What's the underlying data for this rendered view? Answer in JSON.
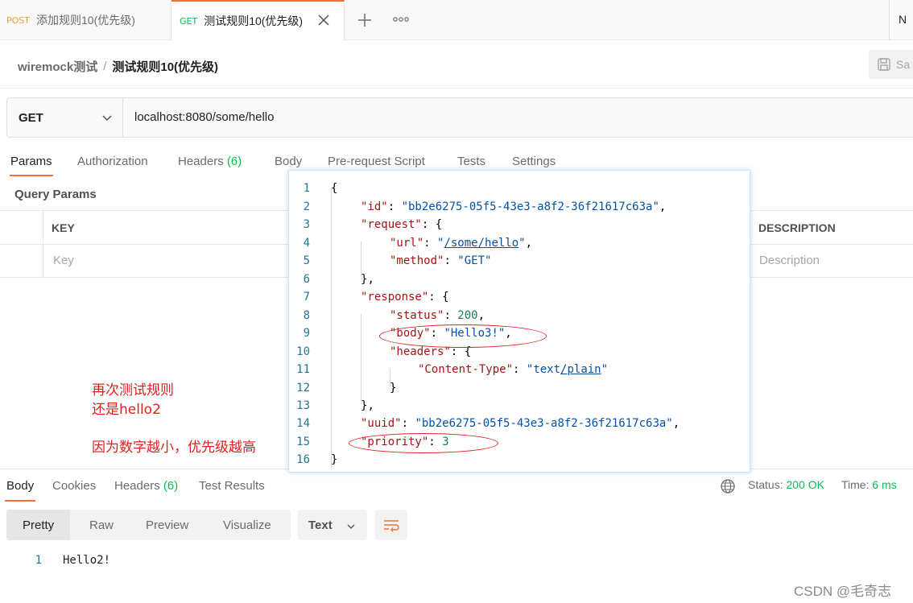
{
  "tabs": [
    {
      "method": "POST",
      "title": "添加规则10(优先级)"
    },
    {
      "method": "GET",
      "title": "测试规则10(优先级)"
    }
  ],
  "tabbar_right_text": "N",
  "breadcrumb": {
    "parent": "wiremock测试",
    "separator": "/",
    "current": "测试规则10(优先级)"
  },
  "save_label": "Sa",
  "request": {
    "method": "GET",
    "url": "localhost:8080/some/hello"
  },
  "request_tabs": [
    {
      "label": "Params",
      "count": ""
    },
    {
      "label": "Authorization",
      "count": ""
    },
    {
      "label": "Headers",
      "count": "(6)"
    },
    {
      "label": "Body",
      "count": ""
    },
    {
      "label": "Pre-request Script",
      "count": ""
    },
    {
      "label": "Tests",
      "count": ""
    },
    {
      "label": "Settings",
      "count": ""
    }
  ],
  "query_params": {
    "title": "Query Params",
    "headers": {
      "key": "KEY",
      "description": "DESCRIPTION"
    },
    "placeholders": {
      "key": "Key",
      "description": "Description"
    }
  },
  "annotation": {
    "line1": "再次测试规则",
    "line2": "还是hello2",
    "line3": "因为数字越小，优先级越高"
  },
  "json_popup": {
    "line_numbers": [
      "1",
      "2",
      "3",
      "4",
      "5",
      "6",
      "7",
      "8",
      "9",
      "10",
      "11",
      "12",
      "13",
      "14",
      "15",
      "16"
    ],
    "brace_open": "{",
    "brace_close": "}",
    "id_key": "\"id\"",
    "id_value": "\"bb2e6275-05f5-43e3-a8f2-36f21617c63a\"",
    "request_key": "\"request\"",
    "url_key": "\"url\"",
    "url_value": "/some/hello",
    "method_key": "\"method\"",
    "method_value": "\"GET\"",
    "response_key": "\"response\"",
    "status_key": "\"status\"",
    "status_value": "200",
    "body_key": "\"body\"",
    "body_value": "\"Hello3!\"",
    "headers_key": "\"headers\"",
    "content_type_key": "\"Content-Type\"",
    "content_type_value_a": "text",
    "content_type_value_b": "/plain",
    "uuid_key": "\"uuid\"",
    "uuid_value": "\"bb2e6275-05f5-43e3-a8f2-36f21617c63a\"",
    "priority_key": "\"priority\"",
    "priority_value": "3"
  },
  "response_tabs": [
    {
      "label": "Body",
      "count": ""
    },
    {
      "label": "Cookies",
      "count": ""
    },
    {
      "label": "Headers",
      "count": "(6)"
    },
    {
      "label": "Test Results",
      "count": ""
    }
  ],
  "response_status": {
    "status_label": "Status:",
    "status_value": "200 OK",
    "time_label": "Time:",
    "time_value": "6 ms"
  },
  "view_tabs": [
    "Pretty",
    "Raw",
    "Preview",
    "Visualize"
  ],
  "format_select": "Text",
  "response_body": {
    "line_number": "1",
    "content": "Hello2!"
  },
  "watermark": "CSDN @毛奇志",
  "colors": {
    "accent": "#ff6c37",
    "success": "#0cbb52",
    "annotation_red": "#e02020"
  },
  "icons": [
    "close-icon",
    "plus-icon",
    "more-icon",
    "save-icon",
    "chevron-down-icon",
    "globe-icon",
    "wrap-lines-icon"
  ]
}
